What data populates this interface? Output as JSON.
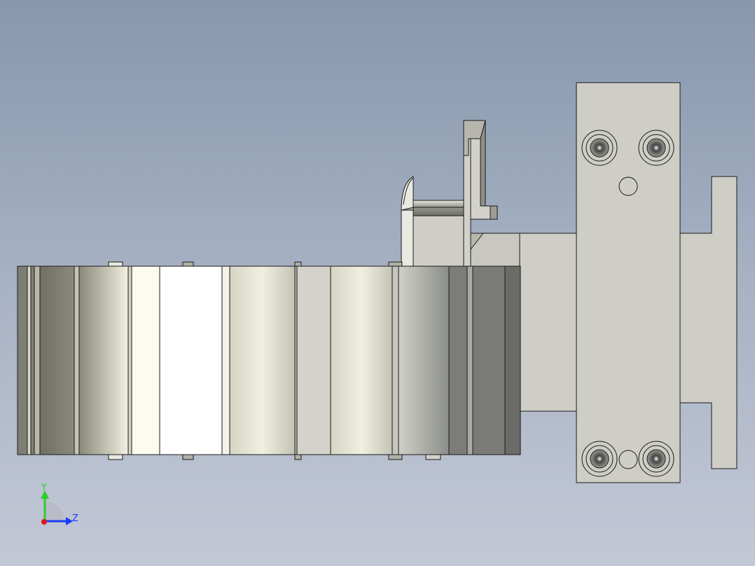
{
  "view": {
    "background_top": "#8797ad",
    "background_bottom": "#c3c8d6",
    "model_fill": "#cfcec6",
    "edge_color": "#1a1a1a"
  },
  "triad": {
    "y_label": "Y",
    "z_label": "Z",
    "y_color": "#2ecc2e",
    "z_color": "#1a3cff",
    "x_color": "#e0141e"
  },
  "parts": {
    "drag_chain": "cable-drag-chain",
    "mount_plate": "vertical-mount-plate",
    "bracket": "end-bracket",
    "screws": 4
  }
}
